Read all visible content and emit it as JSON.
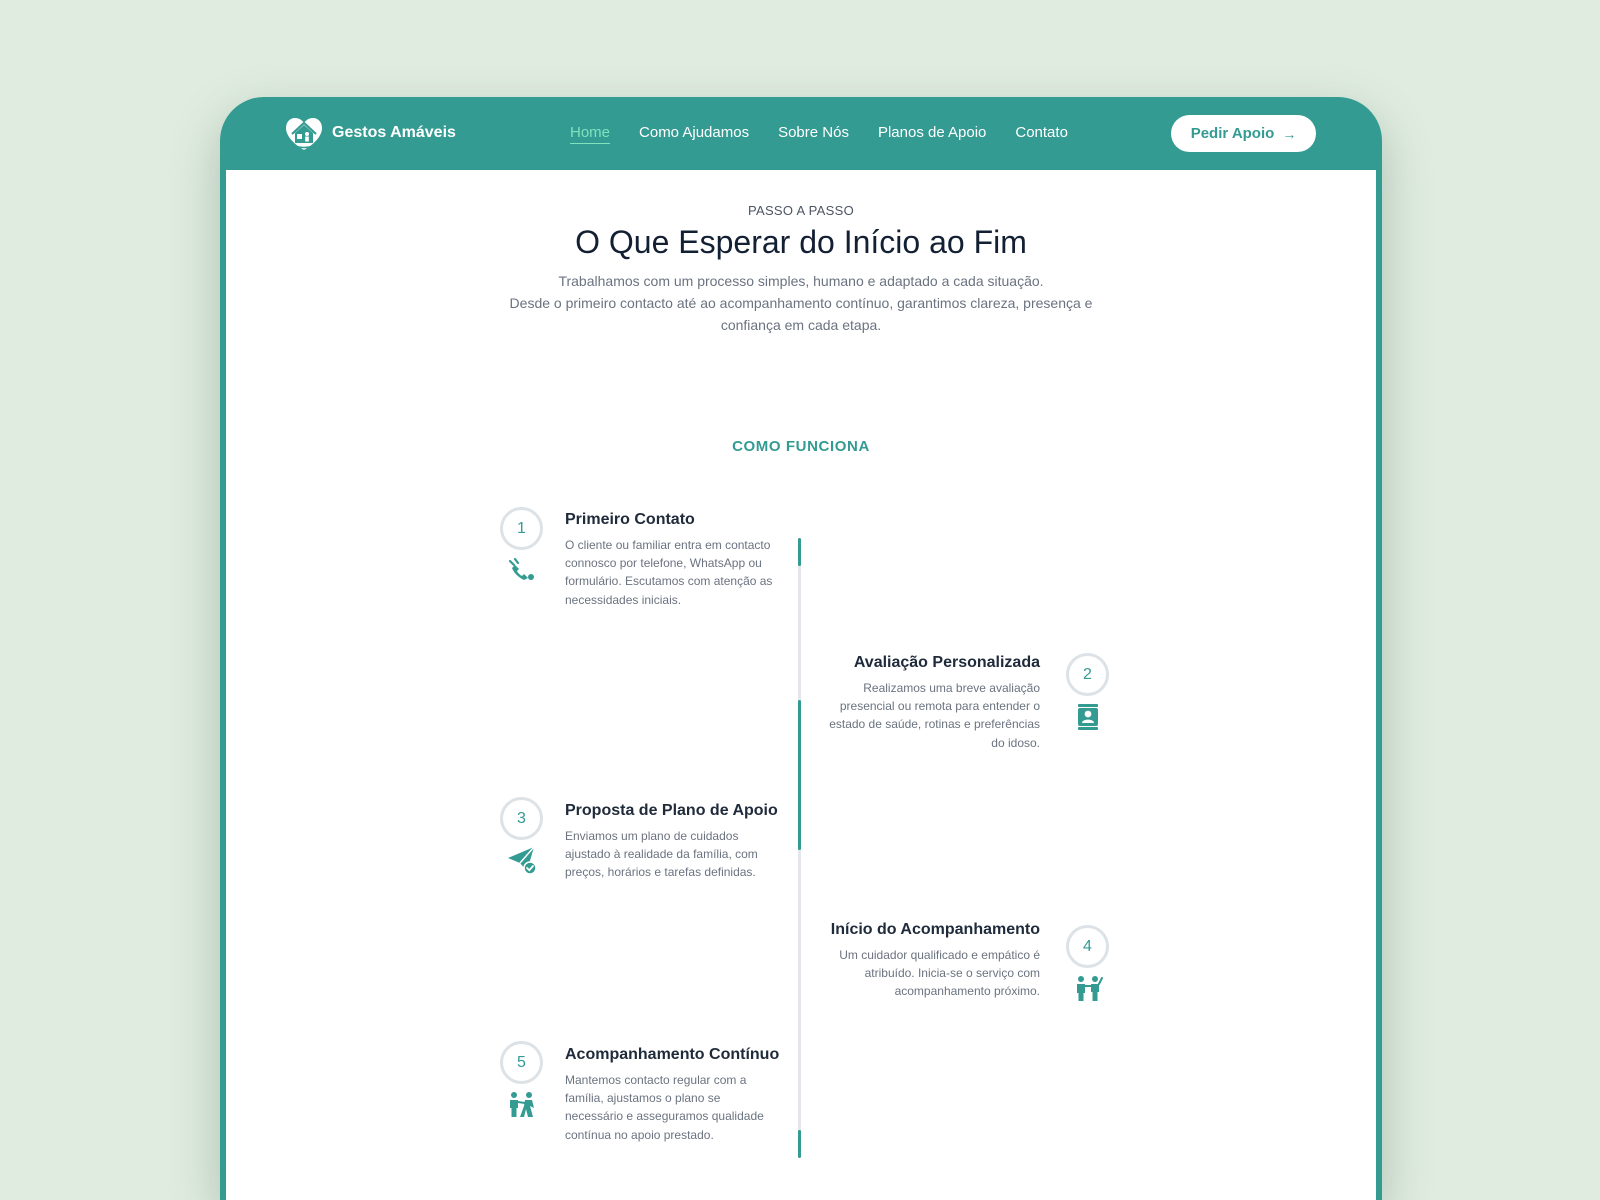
{
  "brand": {
    "name": "Gestos Amáveis",
    "logo_icon": "house-heart-icon"
  },
  "nav": {
    "items": [
      {
        "label": "Home",
        "active": true
      },
      {
        "label": "Como Ajudamos",
        "active": false
      },
      {
        "label": "Sobre Nós",
        "active": false
      },
      {
        "label": "Planos de Apoio",
        "active": false
      },
      {
        "label": "Contato",
        "active": false
      }
    ],
    "cta_label": "Pedir Apoio",
    "cta_icon": "arrow-right-icon"
  },
  "hero": {
    "eyebrow": "PASSO A PASSO",
    "title": "O Que Esperar do Início ao Fim",
    "intro_line1": "Trabalhamos com um processo simples, humano e adaptado a cada situação.",
    "intro_line2": "Desde o primeiro contacto até ao acompanhamento contínuo, garantimos clareza, presença e confiança em cada etapa."
  },
  "process": {
    "label": "COMO FUNCIONA",
    "steps": [
      {
        "number": "1",
        "icon": "phone-call-icon",
        "title": "Primeiro Contato",
        "description": "O cliente ou familiar entra em contacto connosco por telefone, WhatsApp ou formulário. Escutamos com atenção as necessidades iniciais."
      },
      {
        "number": "2",
        "icon": "contact-card-icon",
        "title": "Avaliação Personalizada",
        "description": "Realizamos uma breve avaliação presencial ou remota para entender o estado de saúde, rotinas e preferências do idoso."
      },
      {
        "number": "3",
        "icon": "paper-plane-check-icon",
        "title": "Proposta de Plano de Apoio",
        "description": "Enviamos um plano de cuidados ajustado à realidade da família, com preços, horários e tarefas definidas."
      },
      {
        "number": "4",
        "icon": "caregiver-people-icon",
        "title": "Início do Acompanhamento",
        "description": "Um cuidador qualificado e empático é atribuído. Inicia-se o serviço com acompanhamento próximo."
      },
      {
        "number": "5",
        "icon": "walking-support-icon",
        "title": "Acompanhamento Contínuo",
        "description": "Mantemos contacto regular com a família, ajustamos o plano se necessário e asseguramos qualidade contínua no apoio prestado."
      }
    ]
  },
  "colors": {
    "brand": "#339b92",
    "active_nav": "#7fe3bf",
    "page_bg": "#e0ece0",
    "heading": "#132033"
  }
}
